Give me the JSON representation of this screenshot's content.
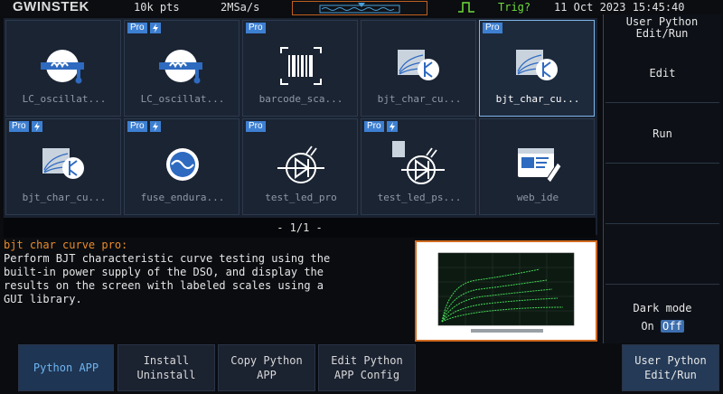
{
  "statusbar": {
    "brand": "GWINSTEK",
    "points": "10k pts",
    "sample_rate": "2MSa/s",
    "trigger": "Trig?",
    "datetime": "11 Oct 2023 15:45:40"
  },
  "apps": [
    {
      "label": "LC_oscillat...",
      "pro": false,
      "bolt": false,
      "icon": "lc-oscillator-icon"
    },
    {
      "label": "LC_oscillat...",
      "pro": true,
      "bolt": true,
      "icon": "lc-oscillator-icon"
    },
    {
      "label": "barcode_sca...",
      "pro": true,
      "bolt": false,
      "icon": "barcode-icon"
    },
    {
      "label": "bjt_char_cu...",
      "pro": false,
      "bolt": false,
      "icon": "bjt-curve-icon"
    },
    {
      "label": "bjt_char_cu...",
      "pro": true,
      "bolt": false,
      "icon": "bjt-curve-icon",
      "selected": true
    },
    {
      "label": "bjt_char_cu...",
      "pro": true,
      "bolt": true,
      "icon": "bjt-curve-icon"
    },
    {
      "label": "fuse_endura...",
      "pro": true,
      "bolt": true,
      "icon": "fuse-icon"
    },
    {
      "label": "test_led_pro",
      "pro": true,
      "bolt": false,
      "icon": "led-icon"
    },
    {
      "label": "test_led_ps...",
      "pro": true,
      "bolt": true,
      "icon": "led-power-icon"
    },
    {
      "label": "web_ide",
      "pro": false,
      "bolt": false,
      "icon": "web-ide-icon"
    }
  ],
  "pager": "- 1/1 -",
  "description": {
    "title": "bjt char curve pro:",
    "body": "Perform BJT characteristic curve testing using the\nbuilt-in power supply of the DSO, and display the\nresults on the screen with labeled scales using a\nGUI library."
  },
  "sidemenu": {
    "title_line1": "User Python",
    "title_line2": "Edit/Run",
    "edit": "Edit",
    "run": "Run",
    "dark_mode": "Dark mode",
    "on": "On",
    "off": "Off"
  },
  "softkeys": {
    "python_app": "Python APP",
    "install_1": "Install",
    "install_2": "Uninstall",
    "copy_1": "Copy Python",
    "copy_2": "APP",
    "edit_1": "Edit Python",
    "edit_2": "APP Config",
    "user_1": "User Python",
    "user_2": "Edit/Run"
  },
  "badge_pro": "Pro",
  "colors": {
    "accent": "#3d7fd1",
    "highlight": "#e98b2a",
    "trig": "#6fdc3c"
  }
}
